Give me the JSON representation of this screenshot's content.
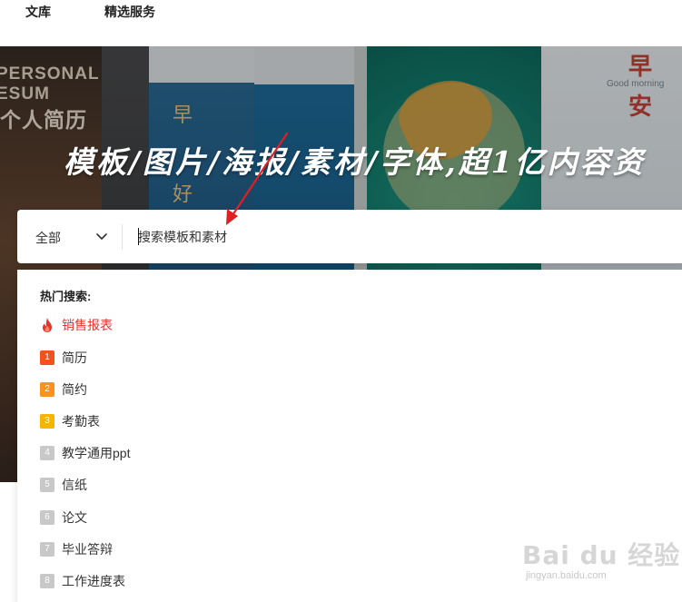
{
  "nav": {
    "items": [
      "文库",
      "精选服务"
    ]
  },
  "hero": {
    "slogan": "模板/图片/海报/素材/字体,超1亿内容资",
    "poster_texts": {
      "personal_line1": "PERSONAL",
      "personal_line2": "ESUM",
      "personal_cn": "个人简历",
      "zao": "早",
      "an": "安",
      "hao": "好",
      "good_morning": "Good morning"
    }
  },
  "search": {
    "category": "全部",
    "placeholder": "搜索模板和素材"
  },
  "dropdown": {
    "title": "热门搜索:",
    "hot_item": "销售报表",
    "items": [
      {
        "rank": "1",
        "label": "简历",
        "color": "#f4511e"
      },
      {
        "rank": "2",
        "label": "简约",
        "color": "#f7931e"
      },
      {
        "rank": "3",
        "label": "考勤表",
        "color": "#f7b500"
      },
      {
        "rank": "4",
        "label": "教学通用ppt",
        "color": "#c8c8c8"
      },
      {
        "rank": "5",
        "label": "信纸",
        "color": "#c8c8c8"
      },
      {
        "rank": "6",
        "label": "论文",
        "color": "#c8c8c8"
      },
      {
        "rank": "7",
        "label": "毕业答辩",
        "color": "#c8c8c8"
      },
      {
        "rank": "8",
        "label": "工作进度表",
        "color": "#c8c8c8"
      }
    ]
  },
  "watermark": {
    "logo": "Bai du 经验",
    "sub": "jingyan.baidu.com"
  },
  "colors": {
    "hot": "#e3342f",
    "annotation": "#e02020"
  },
  "icons": {
    "chevron": "chevron-down-icon",
    "flame": "flame-icon"
  }
}
